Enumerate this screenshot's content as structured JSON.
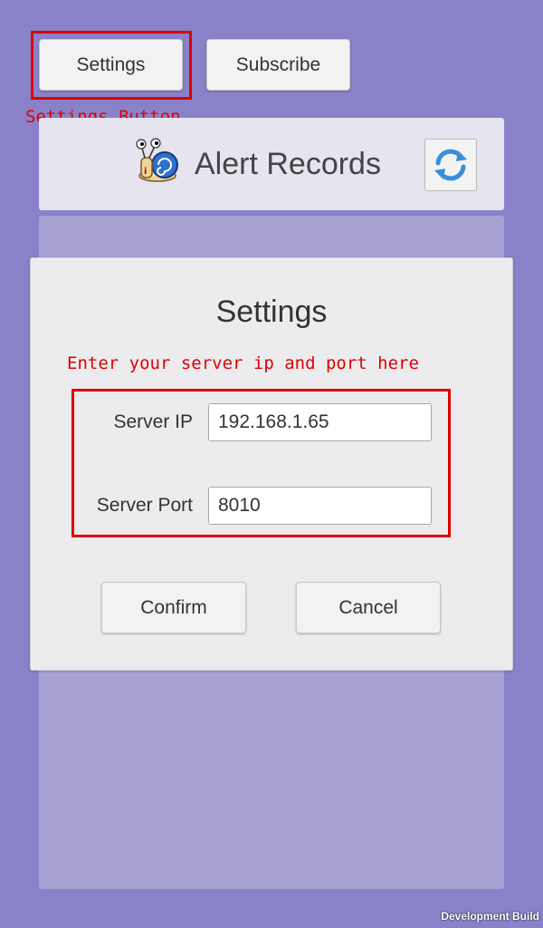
{
  "toolbar": {
    "settings_label": "Settings",
    "subscribe_label": "Subscribe"
  },
  "annotations": {
    "settings_button_note": "Settings Button",
    "server_note": "Enter your server ip and port here"
  },
  "header": {
    "title": "Alert Records",
    "logo_icon": "snail-icon",
    "refresh_icon": "refresh-icon"
  },
  "dialog": {
    "title": "Settings",
    "server_ip_label": "Server IP",
    "server_ip_value": "192.168.1.65",
    "server_port_label": "Server Port",
    "server_port_value": "8010",
    "confirm_label": "Confirm",
    "cancel_label": "Cancel"
  },
  "footer": {
    "build_label": "Development Build"
  },
  "colors": {
    "background": "#8a82c8",
    "panel": "#a8a2d2",
    "annotation": "#e00000"
  }
}
